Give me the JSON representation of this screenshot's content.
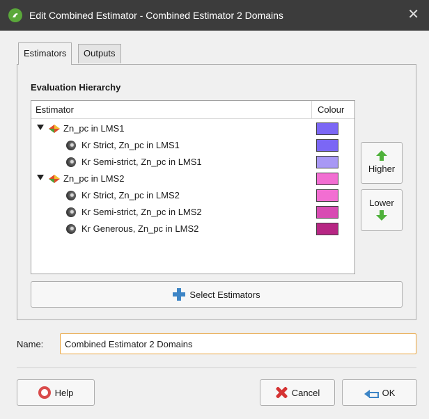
{
  "window": {
    "title": "Edit Combined Estimator - Combined Estimator 2 Domains",
    "close_glyph": "✕"
  },
  "tabs": [
    {
      "label": "Estimators",
      "active": true
    },
    {
      "label": "Outputs",
      "active": false
    }
  ],
  "hierarchy": {
    "title": "Evaluation Hierarchy",
    "col_estimator": "Estimator",
    "col_colour": "Colour",
    "rows": [
      {
        "label": "Zn_pc in LMS1",
        "kind": "domain",
        "color": "#7b67f5"
      },
      {
        "label": "Kr Strict, Zn_pc in LMS1",
        "kind": "estimator",
        "color": "#7b67f5"
      },
      {
        "label": "Kr Semi-strict, Zn_pc in LMS1",
        "kind": "estimator",
        "color": "#a898f5"
      },
      {
        "label": "Zn_pc in LMS2",
        "kind": "domain",
        "color": "#f26ed2"
      },
      {
        "label": "Kr Strict, Zn_pc in LMS2",
        "kind": "estimator",
        "color": "#f26ed2"
      },
      {
        "label": "Kr Semi-strict, Zn_pc in LMS2",
        "kind": "estimator",
        "color": "#d84bb3"
      },
      {
        "label": "Kr Generous, Zn_pc in LMS2",
        "kind": "estimator",
        "color": "#b72684"
      }
    ]
  },
  "buttons": {
    "higher": "Higher",
    "lower": "Lower",
    "select_estimators": "Select Estimators",
    "help": "Help",
    "cancel": "Cancel",
    "ok": "OK"
  },
  "name_field": {
    "label": "Name:",
    "value": "Combined Estimator 2 Domains"
  },
  "icons": {
    "app": "app-logo-icon",
    "domain": "domain-icon",
    "estimator": "estimator-icon",
    "higher": "green-up-arrow-icon",
    "lower": "green-down-arrow-icon",
    "select": "plus-icon",
    "help": "lifebuoy-icon",
    "cancel": "red-x-icon",
    "ok": "return-arrow-icon"
  }
}
